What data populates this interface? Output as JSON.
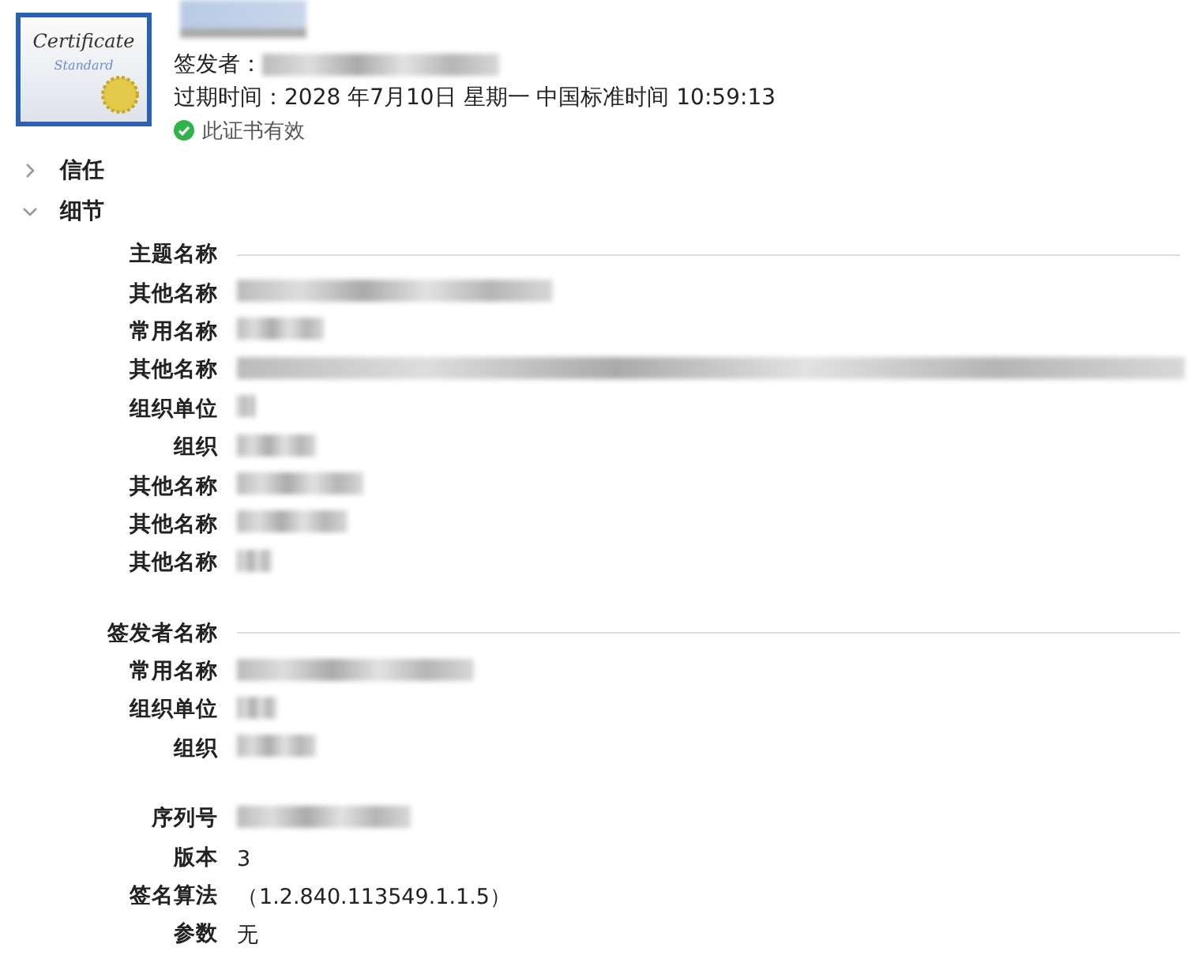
{
  "header": {
    "icon": {
      "title": "Certificate",
      "subtitle": "Standard"
    },
    "title": {
      "redacted": true
    },
    "issuer": {
      "label": "签发者：",
      "redacted": true
    },
    "expiry": "过期时间：2028 年7月10日 星期一 中国标准时间 10:59:13",
    "status": {
      "text": "此证书有效",
      "valid": true
    }
  },
  "sections": [
    {
      "label": "信任",
      "expanded": false
    },
    {
      "label": "细节",
      "expanded": true
    }
  ],
  "groups": [
    {
      "heading": "主题名称",
      "rows": [
        {
          "label": "其他名称",
          "redacted": true
        },
        {
          "label": "常用名称",
          "redacted": true
        },
        {
          "label": "其他名称",
          "redacted": true
        },
        {
          "label": "组织单位",
          "redacted": true
        },
        {
          "label": "组织",
          "redacted": true
        },
        {
          "label": "其他名称",
          "redacted": true
        },
        {
          "label": "其他名称",
          "redacted": true
        },
        {
          "label": "其他名称",
          "redacted": true
        }
      ]
    },
    {
      "heading": "签发者名称",
      "rows": [
        {
          "label": "常用名称",
          "redacted": true
        },
        {
          "label": "组织单位",
          "redacted": true
        },
        {
          "label": "组织",
          "redacted": true
        }
      ]
    },
    {
      "rows": [
        {
          "label": "序列号",
          "redacted": true
        },
        {
          "label": "版本",
          "value": "3",
          "redacted": false
        },
        {
          "label": "签名算法",
          "value": "（1.2.840.113549.1.1.5）",
          "redacted": false
        },
        {
          "label": "参数",
          "value": "无",
          "redacted": false
        }
      ]
    }
  ]
}
